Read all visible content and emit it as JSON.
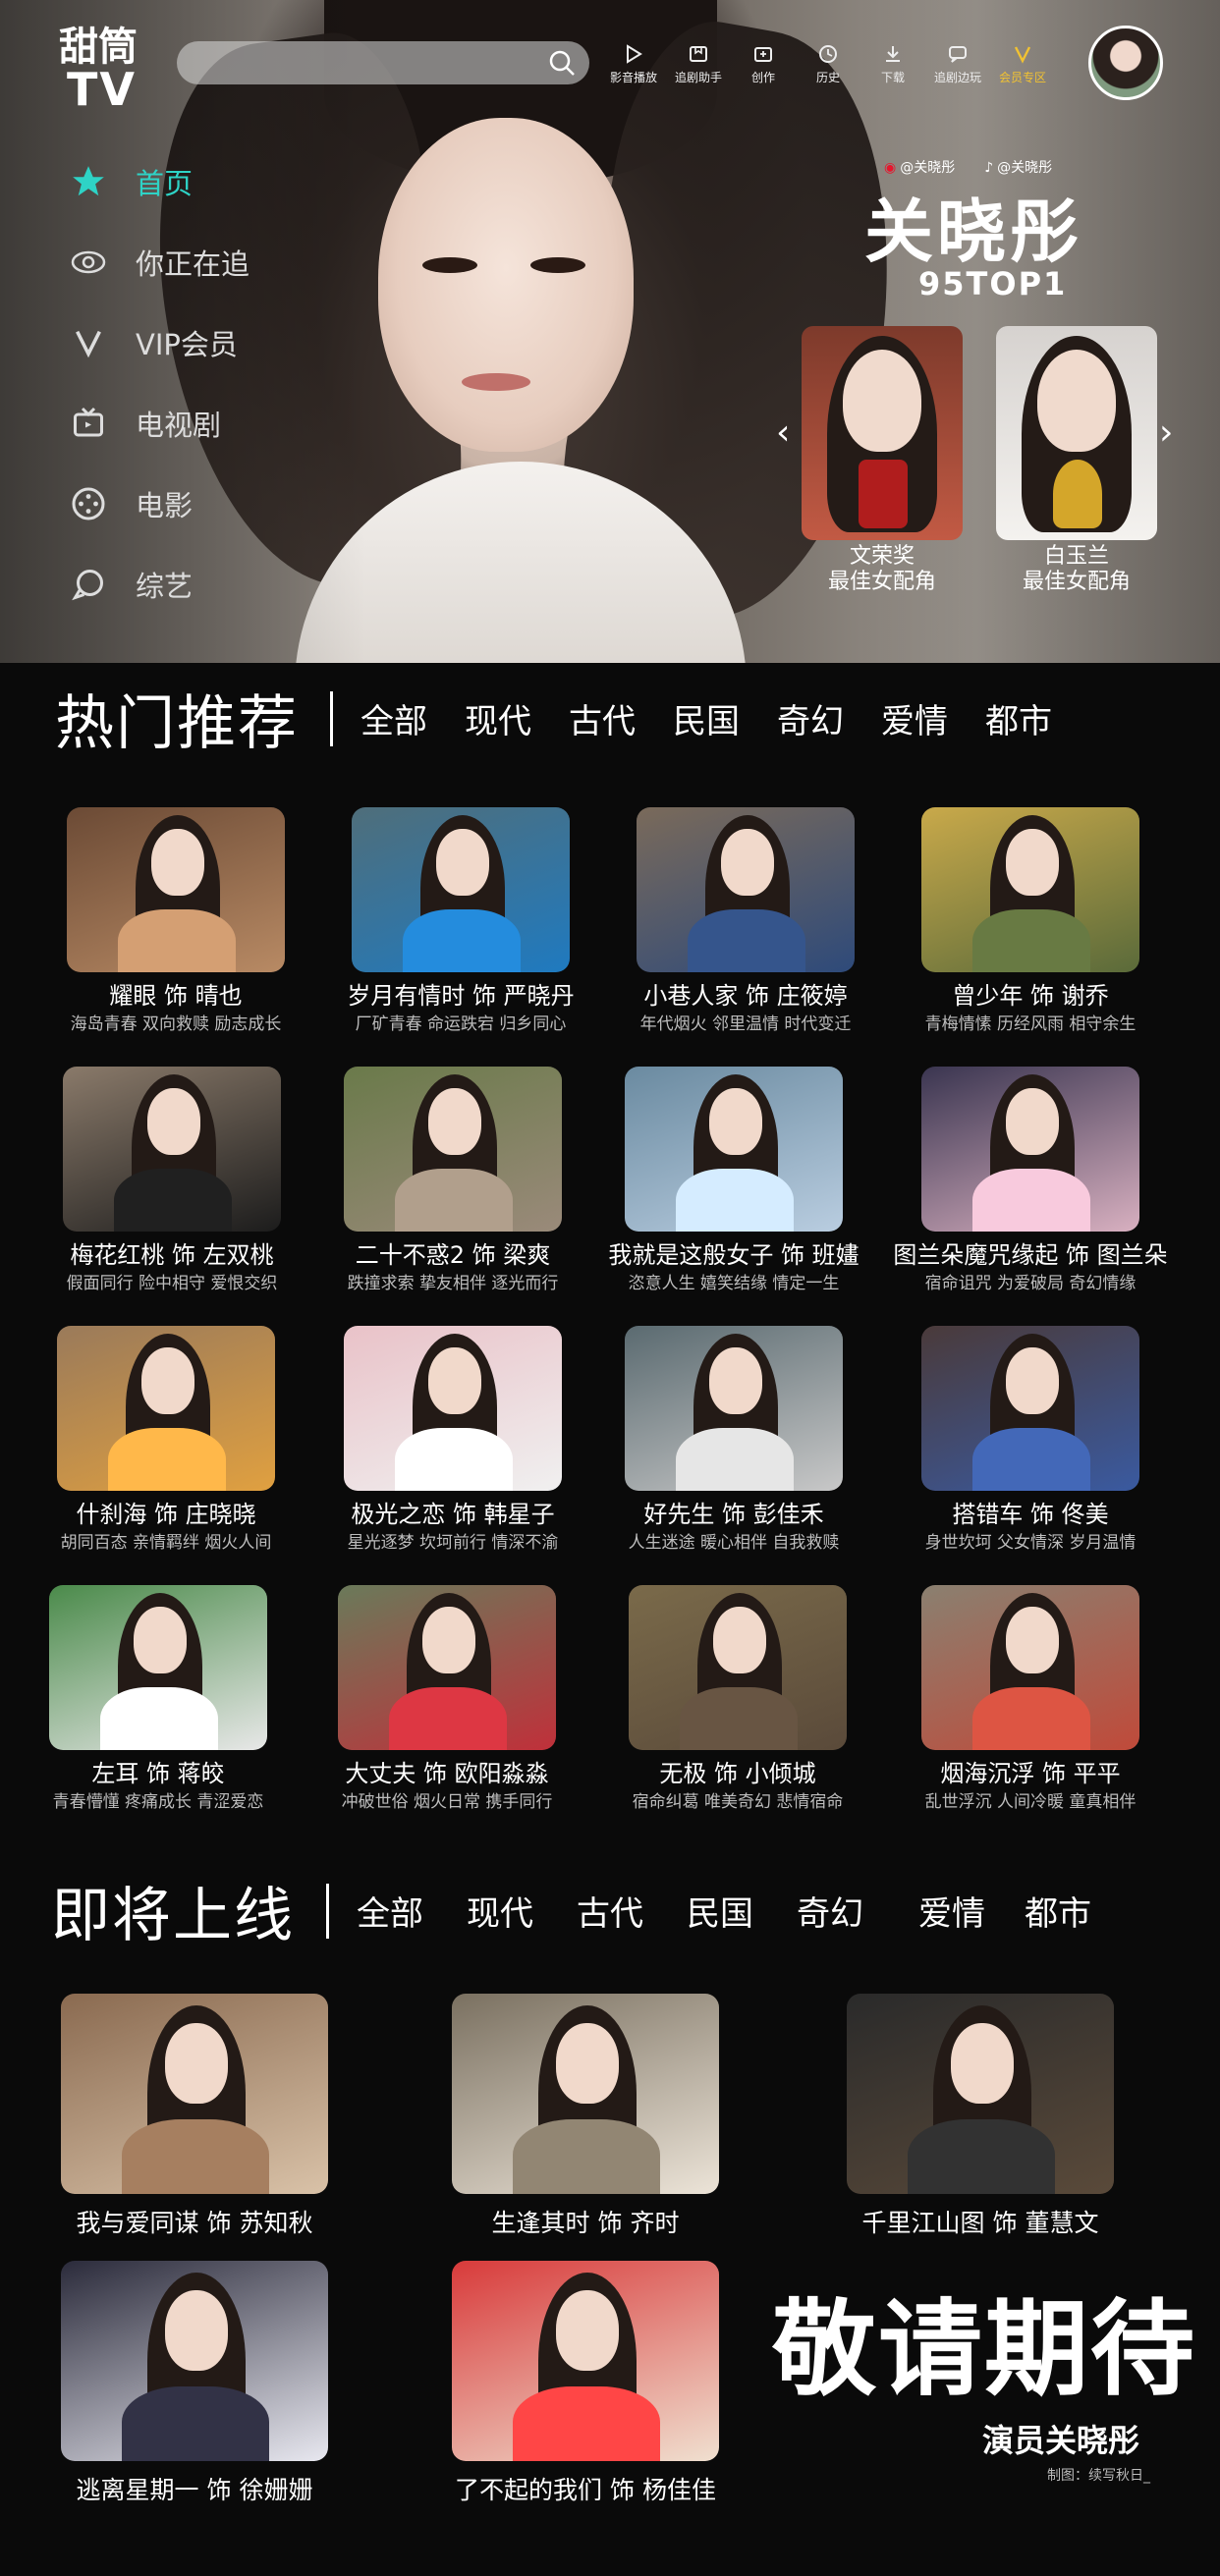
{
  "logo": {
    "line1": "甜筒",
    "line2": "TV"
  },
  "top_nav": [
    {
      "label": "影音播放",
      "icon": "play-icon"
    },
    {
      "label": "追剧助手",
      "icon": "bookmark-icon"
    },
    {
      "label": "创作",
      "icon": "create-icon"
    },
    {
      "label": "历史",
      "icon": "history-icon"
    },
    {
      "label": "下载",
      "icon": "download-icon"
    },
    {
      "label": "追剧边玩",
      "icon": "chat-icon"
    },
    {
      "label": "会员专区",
      "icon": "vip-icon"
    }
  ],
  "side_menu": [
    {
      "label": "首页",
      "icon": "star-icon"
    },
    {
      "label": "你正在追",
      "icon": "eye-icon"
    },
    {
      "label": "VIP会员",
      "icon": "vip-icon"
    },
    {
      "label": "电视剧",
      "icon": "tv-icon"
    },
    {
      "label": "电影",
      "icon": "film-icon"
    },
    {
      "label": "综艺",
      "icon": "chat-bubble-icon"
    }
  ],
  "hero": {
    "weibo": "@关晓彤",
    "douyin": "@关晓彤",
    "star_name": "关晓彤",
    "rank": "95TOP1",
    "awards": [
      {
        "line1": "文荣奖",
        "line2": "最佳女配角"
      },
      {
        "line1": "白玉兰",
        "line2": "最佳女配角"
      }
    ],
    "prev_arrow": "‹",
    "next_arrow": "›"
  },
  "hot": {
    "title": "热门推荐",
    "tabs": [
      "全部",
      "现代",
      "古代",
      "民国",
      "奇幻",
      "爱情",
      "都市"
    ],
    "items": [
      {
        "title": "耀眼 饰 晴也",
        "sub": "海岛青春 双向救赎 励志成长"
      },
      {
        "title": "岁月有情时 饰 严晓丹",
        "sub": "厂矿青春 命运跌宕 归乡同心"
      },
      {
        "title": "小巷人家 饰 庄筱婷",
        "sub": "年代烟火 邻里温情 时代变迁"
      },
      {
        "title": "曾少年 饰 谢乔",
        "sub": "青梅情愫 历经风雨 相守余生"
      },
      {
        "title": "梅花红桃 饰 左双桃",
        "sub": "假面同行 险中相守 爱恨交织"
      },
      {
        "title": "二十不惑2 饰 梁爽",
        "sub": "跌撞求索 挚友相伴 逐光而行"
      },
      {
        "title": "我就是这般女子 饰 班嫿",
        "sub": "恣意人生 嬉笑结缘 情定一生"
      },
      {
        "title": "图兰朵魔咒缘起 饰 图兰朵",
        "sub": "宿命诅咒 为爱破局 奇幻情缘"
      },
      {
        "title": "什刹海 饰 庄晓晓",
        "sub": "胡同百态 亲情羁绊 烟火人间"
      },
      {
        "title": "极光之恋 饰 韩星子",
        "sub": "星光逐梦 坎坷前行 情深不渝"
      },
      {
        "title": "好先生 饰 彭佳禾",
        "sub": "人生迷途 暖心相伴 自我救赎"
      },
      {
        "title": "搭错车 饰 佟美",
        "sub": "身世坎坷 父女情深 岁月温情"
      },
      {
        "title": "左耳 饰 蒋皎",
        "sub": "青春懵懂 疼痛成长 青涩爱恋"
      },
      {
        "title": "大丈夫 饰 欧阳淼淼",
        "sub": "冲破世俗 烟火日常 携手同行"
      },
      {
        "title": "无极 饰 小倾城",
        "sub": "宿命纠葛 唯美奇幻 悲情宿命"
      },
      {
        "title": "烟海沉浮 饰 平平",
        "sub": "乱世浮沉 人间冷暖 童真相伴"
      }
    ]
  },
  "upcoming": {
    "title": "即将上线",
    "tabs": [
      "全部",
      "现代",
      "古代",
      "民国",
      "奇幻",
      "爱情",
      "都市"
    ],
    "items": [
      {
        "title": "我与爱同谋 饰 苏知秋"
      },
      {
        "title": "生逢其时 饰 齐时"
      },
      {
        "title": "千里江山图 饰 董慧文"
      },
      {
        "title": "逃离星期一 饰 徐姗姗"
      },
      {
        "title": "了不起的我们 饰 杨佳佳"
      }
    ],
    "expect": "敬请期待",
    "expect_actor": "演员关晓彤",
    "credit": "制图：续写秋日_"
  },
  "colors": {
    "accent": "#2ed3c6",
    "vip": "#f1c232",
    "background": "#0a0a0a"
  }
}
